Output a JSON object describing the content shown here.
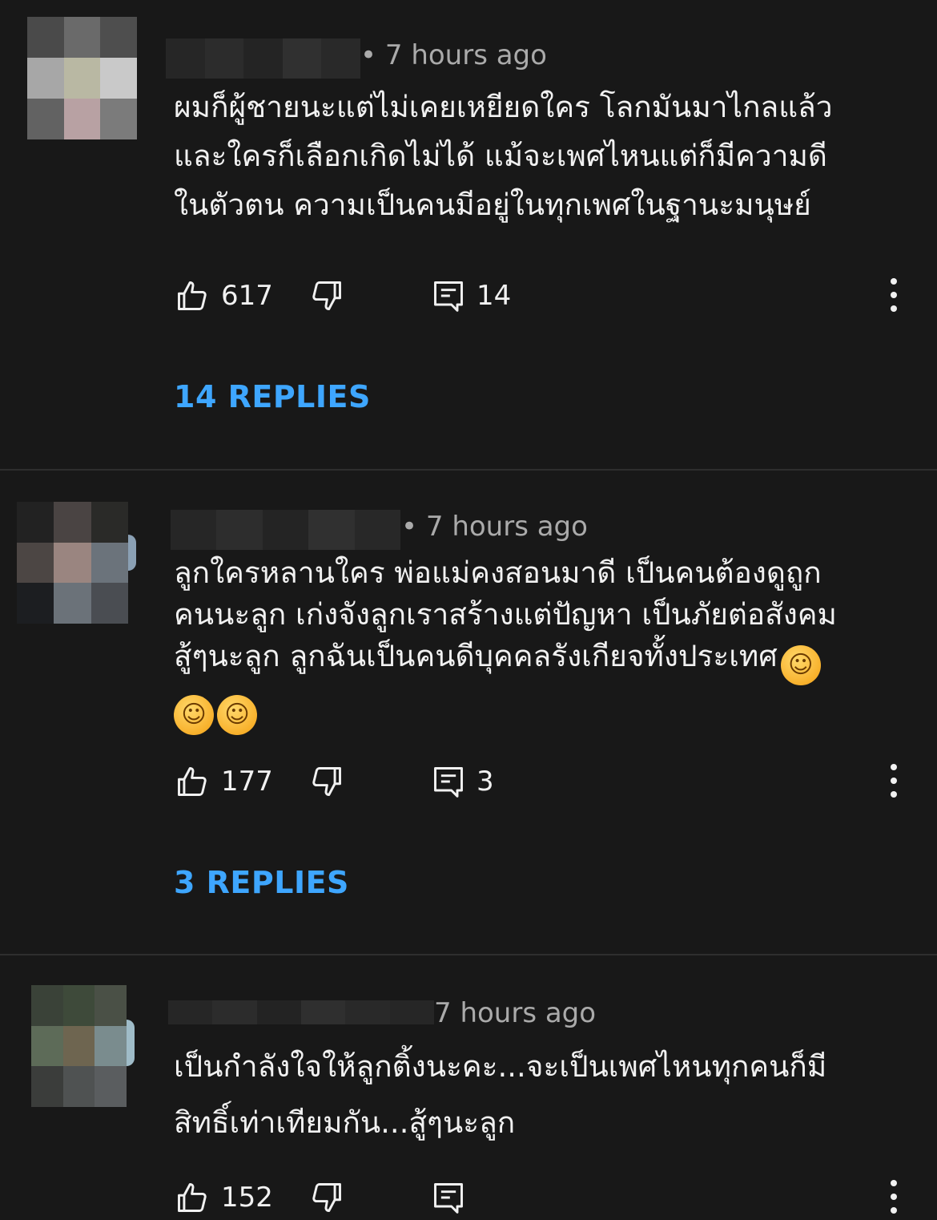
{
  "colors": {
    "background": "#181818",
    "text_primary": "#f1f1f1",
    "text_secondary": "#aaaaaa",
    "link": "#3ea6ff",
    "divider": "#2e2e2e"
  },
  "icons": {
    "like": "thumbs-up-icon",
    "dislike": "thumbs-down-icon",
    "reply": "comment-icon",
    "more": "more-vert-icon"
  },
  "comments": [
    {
      "time": "7 hours ago",
      "text_lines": [
        "ผมก็ผู้ชายนะแต่ไม่เคยเหยียดใคร โลกมันมาไกลแล้ว",
        "และใครก็เลือกเกิดไม่ได้ แม้จะเพศไหนแต่ก็มีความดี",
        "ในตัวตน ความเป็นคนมีอยู่ในทุกเพศในฐานะมนุษย์"
      ],
      "likes": "617",
      "reply_count": "14",
      "replies_label": "14 REPLIES"
    },
    {
      "time": "7 hours ago",
      "text_lines": [
        "ลูกใครหลานใคร พ่อแม่คงสอนมาดี เป็นคนต้องดูถูก",
        "คนนะลูก เก่งจังลูกเราสร้างแต่ปัญหา เป็นภัยต่อสังคม",
        "สู้ๆนะลูก ลูกฉันเป็นคนดีบุคคลรังเกียจทั้งประเทศ",
        ""
      ],
      "emoji": "☺",
      "likes": "177",
      "reply_count": "3",
      "replies_label": "3 REPLIES"
    },
    {
      "time": "7 hours ago",
      "text_lines": [
        "เป็นกำลังใจให้ลูกติ้งนะคะ...จะเป็นเพศไหนทุกคนก็มี",
        "สิทธิ์เท่าเทียมกัน...สู้ๆนะลูก"
      ],
      "likes": "152"
    }
  ]
}
